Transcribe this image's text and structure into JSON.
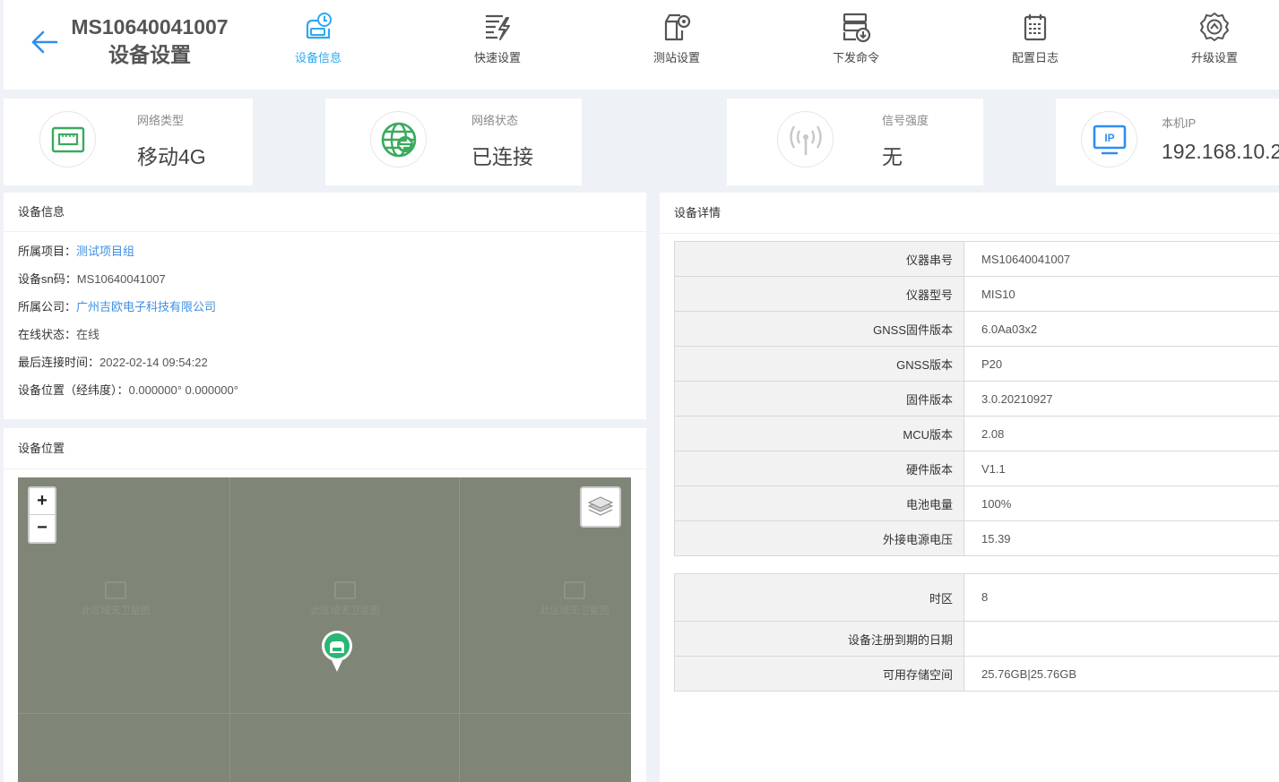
{
  "header": {
    "sn": "MS10640041007",
    "subtitle": "设备设置",
    "nav": [
      {
        "label": "设备信息",
        "icon": "device-info-icon",
        "active": true
      },
      {
        "label": "快速设置",
        "icon": "quick-settings-icon"
      },
      {
        "label": "测站设置",
        "icon": "station-settings-icon"
      },
      {
        "label": "下发命令",
        "icon": "send-command-icon"
      },
      {
        "label": "配置日志",
        "icon": "config-log-icon"
      },
      {
        "label": "升级设置",
        "icon": "upgrade-settings-icon"
      }
    ]
  },
  "status_cards": [
    {
      "label": "网络类型",
      "value": "移动4G",
      "icon": "network-card-icon",
      "color": "#3aaa5c"
    },
    {
      "label": "网络状态",
      "value": "已连接",
      "icon": "globe-icon",
      "color": "#3aaa5c"
    },
    {
      "label": "信号强度",
      "value": "无",
      "icon": "signal-antenna-icon",
      "color": "#cccccc"
    },
    {
      "label": "本机IP",
      "value": "192.168.10.2",
      "icon": "ip-monitor-icon",
      "color": "#2e8ef0"
    }
  ],
  "device_info": {
    "title": "设备信息",
    "rows": [
      {
        "key": "所属项目：",
        "value": "测试项目组",
        "link": true
      },
      {
        "key": "设备sn码：",
        "value": "MS10640041007",
        "link": false
      },
      {
        "key": "所属公司：",
        "value": "广州吉欧电子科技有限公司",
        "link": true
      },
      {
        "key": "在线状态：",
        "value": "在线",
        "link": false
      },
      {
        "key": "最后连接时间：",
        "value": "2022-02-14 09:54:22",
        "link": false
      },
      {
        "key": "设备位置（经纬度）：",
        "value": "0.000000° 0.000000°",
        "link": false
      }
    ]
  },
  "device_location": {
    "title": "设备位置",
    "zoom_in": "+",
    "zoom_out": "−",
    "tile_placeholder": "此区域无卫星图"
  },
  "device_detail": {
    "title": "设备详情",
    "table1": [
      {
        "key": "仪器串号",
        "value": "MS10640041007"
      },
      {
        "key": "仪器型号",
        "value": "MIS10"
      },
      {
        "key": "GNSS固件版本",
        "value": "6.0Aa03x2"
      },
      {
        "key": "GNSS版本",
        "value": "P20"
      },
      {
        "key": "固件版本",
        "value": "3.0.20210927"
      },
      {
        "key": "MCU版本",
        "value": "2.08"
      },
      {
        "key": "硬件版本",
        "value": "V1.1"
      },
      {
        "key": "电池电量",
        "value": "100%"
      },
      {
        "key": "外接电源电压",
        "value": "15.39"
      }
    ],
    "table2": [
      {
        "key": "时区",
        "value": "8"
      },
      {
        "key": "设备注册到期的日期",
        "value": ""
      },
      {
        "key": "可用存储空间",
        "value": "25.76GB|25.76GB"
      }
    ]
  }
}
